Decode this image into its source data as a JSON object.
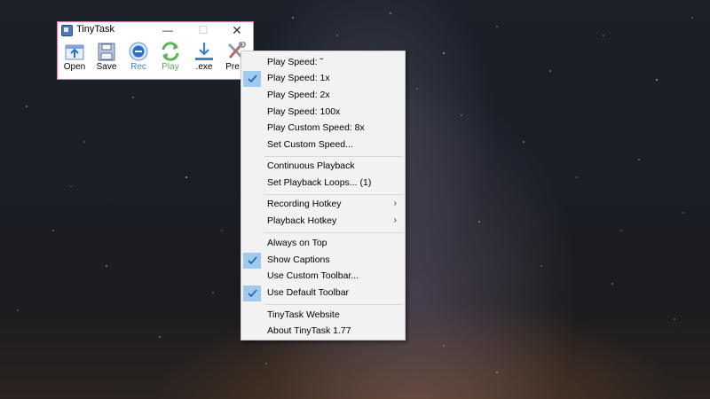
{
  "window": {
    "title": "TinyTask",
    "minimize_glyph": "—",
    "maximize_glyph": "☐",
    "close_glyph": "✕",
    "border_color": "#d97aa9"
  },
  "toolbar": [
    {
      "label": "Open",
      "icon": "open-icon"
    },
    {
      "label": "Save",
      "icon": "save-icon"
    },
    {
      "label": "Rec",
      "icon": "record-icon"
    },
    {
      "label": "Play",
      "icon": "play-icon"
    },
    {
      "label": ".exe",
      "icon": "compile-exe-icon"
    },
    {
      "label": "Pre",
      "icon": "preferences-icon"
    }
  ],
  "menu": {
    "items": [
      {
        "label": "Play Speed:  ˜",
        "checked": false,
        "submenu": false
      },
      {
        "label": "Play Speed:   1x",
        "checked": true,
        "submenu": false
      },
      {
        "label": "Play Speed:   2x",
        "checked": false,
        "submenu": false
      },
      {
        "label": "Play Speed:   100x",
        "checked": false,
        "submenu": false
      },
      {
        "label": "Play Custom Speed:  8x",
        "checked": false,
        "submenu": false
      },
      {
        "label": "Set Custom Speed...",
        "checked": false,
        "submenu": false
      },
      {
        "label": "Continuous Playback",
        "checked": false,
        "submenu": false
      },
      {
        "label": "Set Playback Loops...  (1)",
        "checked": false,
        "submenu": false
      },
      {
        "label": "Recording Hotkey",
        "checked": false,
        "submenu": true
      },
      {
        "label": "Playback Hotkey",
        "checked": false,
        "submenu": true
      },
      {
        "label": "Always on Top",
        "checked": false,
        "submenu": false
      },
      {
        "label": "Show Captions",
        "checked": true,
        "submenu": false
      },
      {
        "label": "Use Custom Toolbar...",
        "checked": false,
        "submenu": false
      },
      {
        "label": "Use Default Toolbar",
        "checked": true,
        "submenu": false
      },
      {
        "label": "TinyTask Website",
        "checked": false,
        "submenu": false
      },
      {
        "label": "About TinyTask 1.77",
        "checked": false,
        "submenu": false
      }
    ],
    "submenu_arrow": "›",
    "check_color": "#9fc9ee"
  }
}
